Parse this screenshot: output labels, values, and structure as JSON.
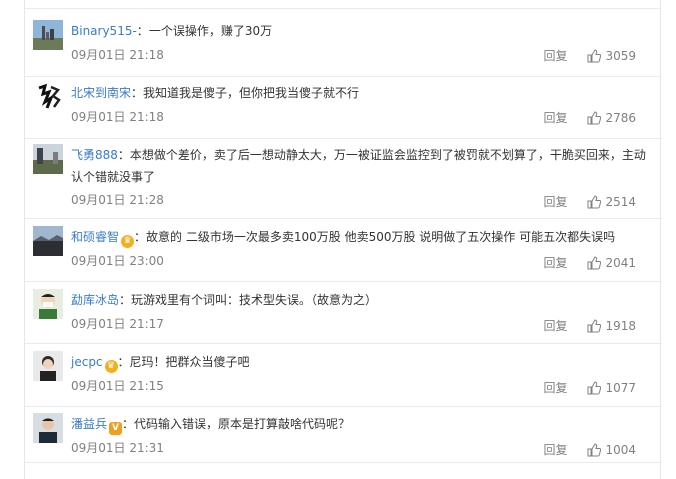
{
  "comments": [
    {
      "user": "Binary515-",
      "sep": "：",
      "text": "一个误操作，赚了30万",
      "time": "09月01日 21:18",
      "reply": "回复",
      "likes": "3059"
    },
    {
      "user": "北宋到南宋",
      "sep": "：",
      "text": "我知道我是傻子，但你把我当傻子就不行",
      "time": "09月01日 21:18",
      "reply": "回复",
      "likes": "2786"
    },
    {
      "user": "飞勇888",
      "sep": "：",
      "text": "本想做个差价，卖了后一想动静太大，万一被证监会监控到了被罚就不划算了，干脆买回来，主动认个错就没事了",
      "time": "09月01日 21:28",
      "reply": "回复",
      "likes": "2514"
    },
    {
      "user": "和硕睿智",
      "sep": "：",
      "text": "故意的 二级市场一次最多卖100万股 他卖500万股 说明做了五次操作 可能五次都失误吗",
      "time": "09月01日 23:00",
      "reply": "回复",
      "likes": "2041"
    },
    {
      "user": "勐库冰岛",
      "sep": "：",
      "text": "玩游戏里有个词叫：技术型失误。（故意为之）",
      "time": "09月01日 21:17",
      "reply": "回复",
      "likes": "1918"
    },
    {
      "user": "jecpc",
      "sep": "：",
      "text": "尼玛！把群众当傻子吧",
      "time": "09月01日 21:15",
      "reply": "回复",
      "likes": "1077"
    },
    {
      "user": "潘益兵",
      "sep": "：",
      "text": "代码输入错误，原本是打算敲啥代码呢？",
      "time": "09月01日 21:31",
      "reply": "回复",
      "likes": "1004"
    }
  ]
}
